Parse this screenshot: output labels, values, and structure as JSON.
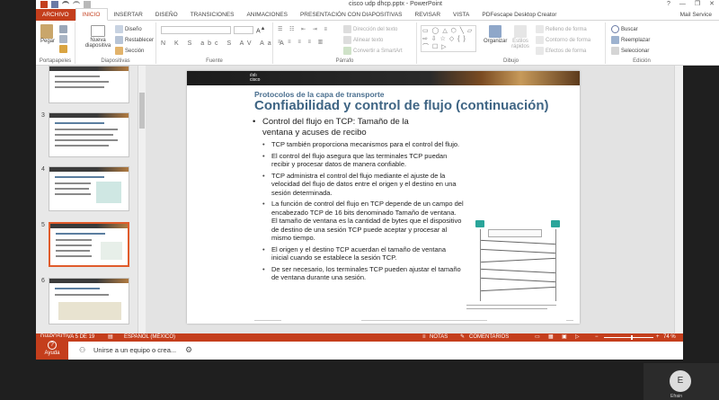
{
  "window": {
    "title": "cisco udp dhcp.pptx - PowerPoint",
    "controls": [
      "?",
      "—",
      "❐",
      "✕"
    ]
  },
  "tabs": [
    {
      "label": "ARCHIVO"
    },
    {
      "label": "INICIO"
    },
    {
      "label": "INSERTAR"
    },
    {
      "label": "DISEÑO"
    },
    {
      "label": "TRANSICIONES"
    },
    {
      "label": "ANIMACIONES"
    },
    {
      "label": "PRESENTACIÓN CON DIAPOSITIVAS"
    },
    {
      "label": "REVISAR"
    },
    {
      "label": "VISTA"
    },
    {
      "label": "PDFescape Desktop Creator"
    }
  ],
  "user": "Mail Service",
  "ribbon": {
    "portapapeles": {
      "label": "Portapapeles",
      "paste": "Pegar"
    },
    "diapositivas": {
      "label": "Diapositivas",
      "new_slide": "Nueva diapositiva",
      "design": "Diseño",
      "reset": "Restablecer",
      "section": "Sección"
    },
    "fuente": {
      "label": "Fuente"
    },
    "parrafo": {
      "label": "Párrafo",
      "text_direction": "Dirección del texto",
      "align_text": "Alinear texto",
      "smartart": "Convertir a SmartArt"
    },
    "dibujo": {
      "label": "Dibujo",
      "arrange": "Organizar",
      "quick_styles": "Estilos rápidos",
      "fill": "Relleno de forma",
      "outline": "Contorno de forma",
      "effects": "Efectos de forma"
    },
    "edicion": {
      "label": "Edición",
      "find": "Buscar",
      "replace": "Reemplazar",
      "select": "Seleccionar"
    }
  },
  "thumbnails": [
    {
      "num": "3"
    },
    {
      "num": "4"
    },
    {
      "num": "5"
    },
    {
      "num": "6"
    }
  ],
  "slide": {
    "subtitle": "Protocolos de la capa de transporte",
    "title": "Confiabilidad y control de flujo (continuación)",
    "main_point": "Control del flujo en TCP: Tamaño de la ventana y acuses de recibo",
    "bullets": [
      "TCP también proporciona mecanismos para el control del flujo.",
      "El control del flujo asegura que las terminales TCP puedan recibir y procesar datos de manera confiable.",
      "TCP administra el control del flujo mediante el ajuste de la velocidad del flujo de datos entre el origen y el destino en una sesión determinada.",
      "La función de control del flujo en TCP depende de un campo del encabezado TCP de 16 bits denominado Tamaño de ventana. El tamaño de ventana es la cantidad de bytes que el dispositivo de destino de una sesión TCP puede aceptar y procesar al mismo tiempo.",
      "El origen y el destino TCP acuerdan el tamaño de ventana inicial cuando se establece la sesión TCP.",
      "De ser necesario, los terminales TCP pueden ajustar el tamaño de ventana durante una sesión."
    ]
  },
  "status": {
    "slide_info": "DIAPOSITIVA 5 DE 19",
    "language": "ESPAÑOL (MÉXICO)",
    "notes": "NOTAS",
    "comments": "COMENTARIOS",
    "zoom": "74 %"
  },
  "help": {
    "label": "Ayuda"
  },
  "join": {
    "text": "Unirse a un equipo o crea..."
  },
  "participant": {
    "initial": "E",
    "name": "Efrain"
  },
  "colors": {
    "accent": "#c43e1c",
    "title": "#3f6584",
    "selected_thumb": "#e05b2b"
  }
}
